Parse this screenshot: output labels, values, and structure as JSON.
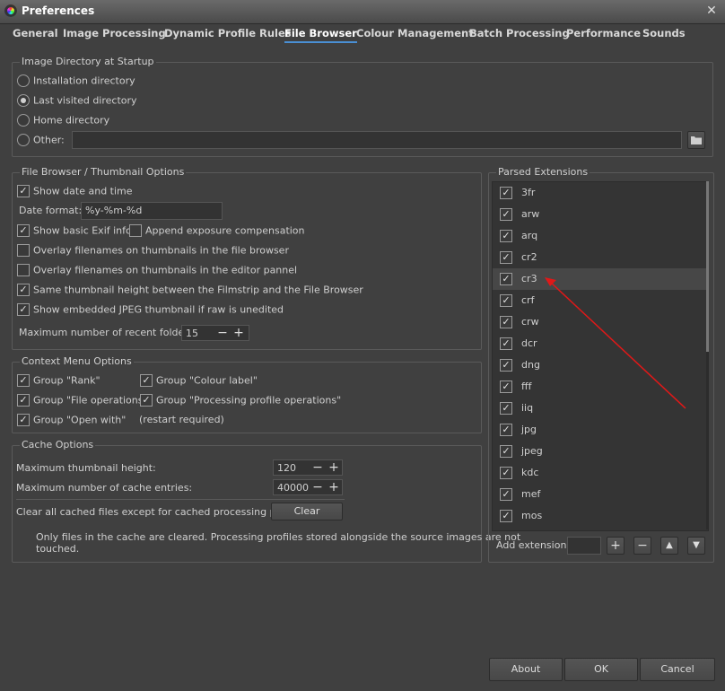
{
  "window": {
    "title": "Preferences",
    "close_glyph": "✕",
    "app_icon": "rawtherapee-icon"
  },
  "tabs": [
    {
      "label": "General"
    },
    {
      "label": "Image Processing"
    },
    {
      "label": "Dynamic Profile Rules"
    },
    {
      "label": "File Browser",
      "active": true
    },
    {
      "label": "Colour Management"
    },
    {
      "label": "Batch Processing"
    },
    {
      "label": "Performance"
    },
    {
      "label": "Sounds"
    }
  ],
  "startup": {
    "legend": "Image Directory at Startup",
    "options": [
      "Installation directory",
      "Last visited directory",
      "Home directory",
      "Other:"
    ],
    "selected": "Last visited directory",
    "other_path": ""
  },
  "thumbs": {
    "legend": "File Browser / Thumbnail Options",
    "show_date_time": "Show date and time",
    "date_format_label": "Date format:",
    "date_format_value": "%y-%m-%d",
    "show_exif": "Show basic Exif info",
    "append_exposure": "Append exposure compensation",
    "overlay_fb": "Overlay filenames on thumbnails in the file browser",
    "overlay_editor": "Overlay filenames on thumbnails in the editor pannel",
    "same_height": "Same thumbnail height between the Filmstrip and the File Browser",
    "embedded_jpeg": "Show embedded JPEG thumbnail if raw is unedited",
    "recent_folders_label": "Maximum number of recent folders:",
    "recent_folders_value": "15"
  },
  "context": {
    "legend": "Context Menu Options",
    "rank": "Group \"Rank\"",
    "colour_label": "Group \"Colour label\"",
    "file_ops": "Group \"File operations\"",
    "proc_ops": "Group \"Processing profile operations\"",
    "open_with": "Group \"Open with\"",
    "restart_note": "(restart required)"
  },
  "cache": {
    "legend": "Cache Options",
    "max_height_label": "Maximum thumbnail height:",
    "max_height_value": "120",
    "max_entries_label": "Maximum number of cache entries:",
    "max_entries_value": "40000",
    "clear_label": "Clear all cached files except for cached processing profiles:",
    "clear_button": "Clear",
    "note_line1": "Only files in the cache are cleared. Processing profiles stored alongside the source images are not",
    "note_line2": "touched."
  },
  "extensions": {
    "legend": "Parsed Extensions",
    "items": [
      "3fr",
      "arw",
      "arq",
      "cr2",
      "cr3",
      "crf",
      "crw",
      "dcr",
      "dng",
      "fff",
      "iiq",
      "jpg",
      "jpeg",
      "kdc",
      "mef",
      "mos"
    ],
    "highlighted": "cr3",
    "add_label": "Add extension:",
    "add_value": ""
  },
  "buttons": {
    "about": "About",
    "ok": "OK",
    "cancel": "Cancel"
  },
  "symbols": {
    "plus": "+",
    "minus": "−",
    "check": "✓",
    "up": "▲",
    "down": "▼"
  },
  "colors": {
    "annotation_arrow": "#e01818",
    "active_tab_underline": "#4a8fd4"
  }
}
